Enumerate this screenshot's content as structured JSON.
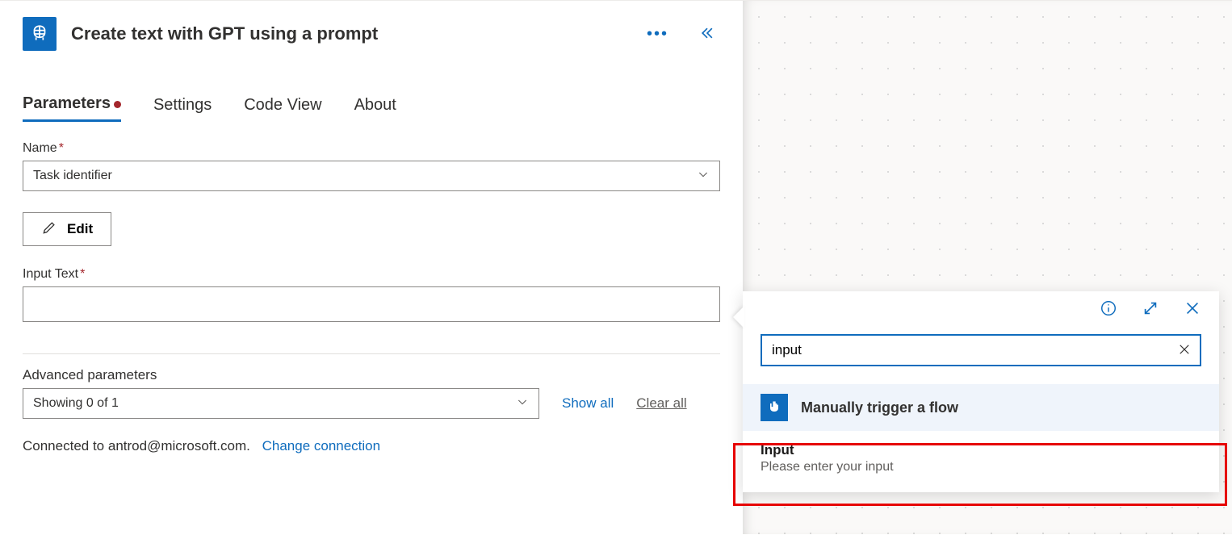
{
  "panel": {
    "title": "Create text with GPT using a prompt"
  },
  "tabs": {
    "parameters": "Parameters",
    "settings": "Settings",
    "codeview": "Code View",
    "about": "About"
  },
  "fields": {
    "name_label": "Name",
    "name_value": "Task identifier",
    "edit_button": "Edit",
    "input_text_label": "Input Text",
    "input_text_value": ""
  },
  "advanced": {
    "label": "Advanced parameters",
    "select_value": "Showing 0 of 1",
    "show_all": "Show all",
    "clear_all": "Clear all"
  },
  "connection": {
    "prefix": "Connected to",
    "account": "antrod@microsoft.com.",
    "change": "Change connection"
  },
  "popup": {
    "search_value": "input",
    "trigger_title": "Manually trigger a flow",
    "item_title": "Input",
    "item_sub": "Please enter your input"
  }
}
